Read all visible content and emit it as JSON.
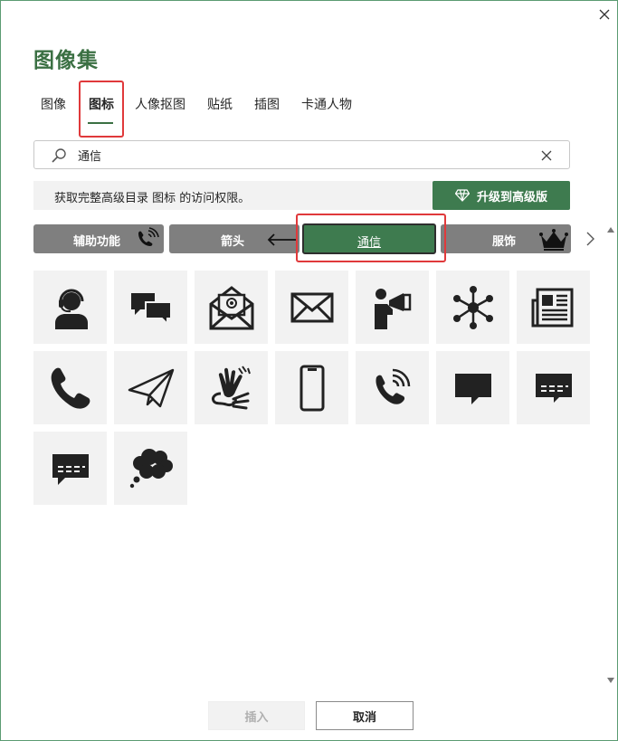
{
  "dialog": {
    "title": "图像集",
    "close_icon": "close-icon"
  },
  "tabs": [
    {
      "label": "图像",
      "active": false
    },
    {
      "label": "图标",
      "active": true
    },
    {
      "label": "人像抠图",
      "active": false
    },
    {
      "label": "贴纸",
      "active": false
    },
    {
      "label": "插图",
      "active": false
    },
    {
      "label": "卡通人物",
      "active": false
    }
  ],
  "search": {
    "value": "通信",
    "placeholder": ""
  },
  "upsell": {
    "message": "获取完整高级目录 图标 的访问权限。",
    "upgrade_label": "升级到高级版"
  },
  "categories": [
    {
      "label": "辅助功能",
      "icon": "phone-signal-icon",
      "active": false
    },
    {
      "label": "箭头",
      "icon": "arrow-left-icon",
      "active": false
    },
    {
      "label": "通信",
      "icon": "",
      "active": true
    },
    {
      "label": "服饰",
      "icon": "crown-icon",
      "active": false
    }
  ],
  "icons": [
    "headset-person-icon",
    "chat-bubbles-icon",
    "email-envelope-icon",
    "mail-envelope-icon",
    "megaphone-person-icon",
    "network-hub-icon",
    "newspaper-icon",
    "phone-handset-icon",
    "paper-plane-icon",
    "sign-language-hands-icon",
    "mobile-phone-icon",
    "phone-ringing-icon",
    "speech-bubble-icon",
    "text-message-icon",
    "chat-message-icon",
    "thought-bubble-icon"
  ],
  "footer": {
    "insert_label": "插入",
    "cancel_label": "取消"
  },
  "colors": {
    "accent": "#3e7b4f",
    "title": "#3b7043",
    "highlight": "#e0393b",
    "category_bg": "#7f7f7f",
    "tile_bg": "#f2f2f2"
  }
}
